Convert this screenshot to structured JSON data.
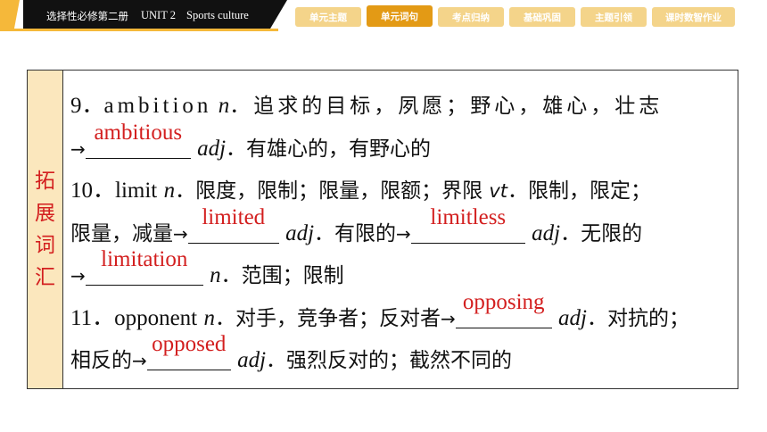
{
  "header": {
    "book": "选择性必修第二册",
    "unit": "UNIT 2",
    "topic": "Sports culture",
    "tabs": [
      {
        "label": "单元主题"
      },
      {
        "label": "单元词句"
      },
      {
        "label": "考点归纳"
      },
      {
        "label": "基础巩固"
      },
      {
        "label": "主题引领"
      },
      {
        "label": "课时数智作业"
      }
    ]
  },
  "panel": {
    "side_label": [
      "拓",
      "展",
      "词",
      "汇"
    ],
    "entries": {
      "e9": {
        "num": "9．",
        "word": "ambition",
        "pos": "n",
        "meaning": "．追求的目标，夙愿；野心，雄心，壮志",
        "arrow": "→",
        "answer": "ambitious",
        "answer_pos": "adj",
        "answer_meaning": "．有雄心的，有野心的"
      },
      "e10": {
        "num": "10．",
        "word": "limit",
        "pos": "n",
        "meaning": "．限度，限制；限量，限额；界限",
        "pos2": "vt",
        "meaning2": "．限制，限定；",
        "meaning3": "限量，减量",
        "arrow": "→",
        "answer1": "limited",
        "pos_a1": "adj",
        "meaning_a1": "．有限的",
        "answer2": "limitless",
        "pos_a2": "adj",
        "meaning_a2": "．无限的",
        "answer3": "limitation",
        "pos_a3": "n",
        "meaning_a3": "．范围；限制"
      },
      "e11": {
        "num": "11．",
        "word": "opponent",
        "pos": "n",
        "meaning": "．对手，竞争者；反对者",
        "arrow": "→",
        "answer1": "opposing",
        "pos_a1": "adj",
        "meaning_a1": "．对抗的；",
        "meaning_a1b": "相反的",
        "answer2": "opposed",
        "pos_a2": "adj",
        "meaning_a2": "．强烈反对的；截然不同的"
      }
    }
  },
  "colors": {
    "accent": "#f5b83a",
    "tab": "#f4d48a",
    "tab_active": "#e39a15",
    "answer": "#d31f1f",
    "side_bg": "#fbe7bd"
  }
}
